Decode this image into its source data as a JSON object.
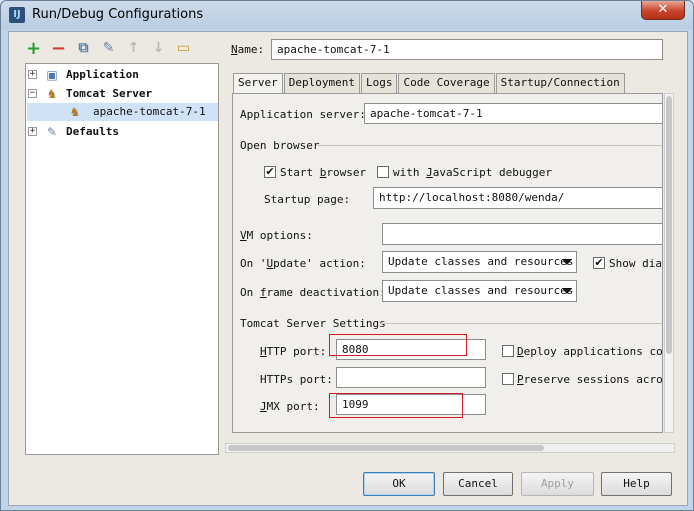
{
  "window": {
    "title": "Run/Debug Configurations",
    "app_icon_text": "IJ",
    "close_glyph": "✕"
  },
  "toolbar": {
    "add_glyph": "+",
    "remove_glyph": "−",
    "copy_glyph": "⧉",
    "edit_glyph": "✎",
    "up_glyph": "↑",
    "down_glyph": "↓",
    "folder_glyph": "▭"
  },
  "tree": {
    "application": {
      "label": "Application",
      "expander": "+"
    },
    "tomcat": {
      "label": "Tomcat Server",
      "expander": "−"
    },
    "config": {
      "label": "apache-tomcat-7-1"
    },
    "defaults": {
      "label": "Defaults",
      "expander": "+"
    }
  },
  "name_field": {
    "label": "Name:",
    "mnemonic": "N",
    "rest": "ame:",
    "value": "apache-tomcat-7-1"
  },
  "tabs": [
    "Server",
    "Deployment",
    "Logs",
    "Code Coverage",
    "Startup/Connection"
  ],
  "server": {
    "app_server_label": "Application server:",
    "app_server_value": "apache-tomcat-7-1",
    "open_browser_title": "Open browser",
    "start_browser": {
      "pre": "Start ",
      "mn": "b",
      "post": "rowser",
      "checked": true
    },
    "js_debugger": {
      "pre": "with ",
      "mn": "J",
      "post": "avaScript debugger",
      "checked": false
    },
    "startup_page_label": "Startup page:",
    "startup_page_value": "http://localhost:8080/wenda/",
    "vm_label_mn": "V",
    "vm_label_rest": "M options:",
    "vm_value": "",
    "on_update": {
      "pre": "On '",
      "mn": "U",
      "post": "pdate' action:",
      "value": "Update classes and resources"
    },
    "show_dialog": {
      "label": "Show dial",
      "checked": true
    },
    "on_frame": {
      "pre": "On ",
      "mn": "f",
      "post": "rame deactivation:",
      "value": "Update classes and resources"
    },
    "tomcat_settings_title": "Tomcat Server Settings",
    "http_port": {
      "mn": "H",
      "rest": "TTP port:",
      "value": "8080"
    },
    "https_port": {
      "mn": "",
      "rest": "HTTPs port:",
      "value": ""
    },
    "jmx_port": {
      "mn": "J",
      "rest": "MX port:",
      "value": "1099"
    },
    "deploy_apps": {
      "pre": "",
      "mn": "D",
      "post": "eploy applications conf",
      "checked": false
    },
    "preserve_sessions": {
      "pre": "",
      "mn": "P",
      "post": "reserve sessions across",
      "checked": false
    }
  },
  "buttons": {
    "ok": "OK",
    "cancel": "Cancel",
    "apply": "Apply",
    "help": "Help"
  }
}
